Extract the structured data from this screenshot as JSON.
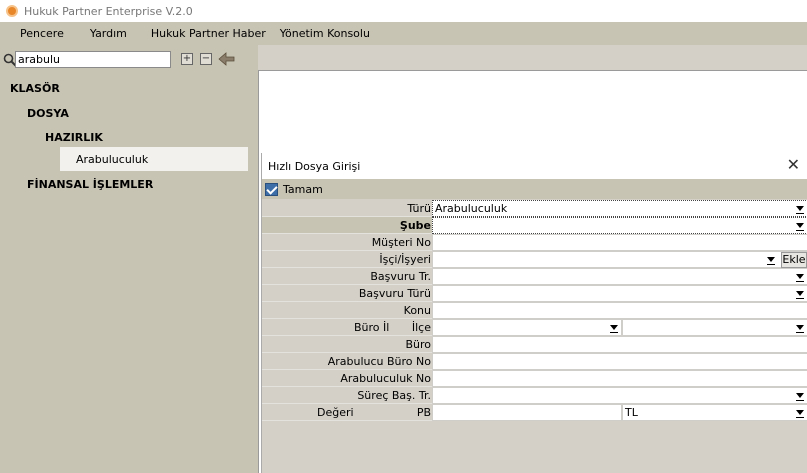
{
  "window": {
    "title": "Hukuk Partner Enterprise V.2.0"
  },
  "menu": [
    "Pencere",
    "Yardım",
    "Hukuk Partner Haber",
    "Yönetim Konsolu"
  ],
  "search": {
    "value": "arabulu",
    "expand_label": "+",
    "collapse_label": "−"
  },
  "tree": {
    "klasor": "KLASÖR",
    "dosya": "DOSYA",
    "hazirlik": "HAZIRLIK",
    "arabuluculuk": "Arabuluculuk",
    "finansal": "FİNANSAL İŞLEMLER"
  },
  "dialog": {
    "title": "Hızlı Dosya Girişi",
    "close_glyph": "✕",
    "tamam": "Tamam",
    "fields": {
      "turu": {
        "label": "Türü",
        "value": "Arabuluculuk"
      },
      "sube": {
        "label": "Şube",
        "value": ""
      },
      "musteri_no": {
        "label": "Müşteri No",
        "value": ""
      },
      "isci_isveren": {
        "label": "İşçi/İşyeri",
        "value": "",
        "button": "Ekle"
      },
      "basvuru_tr": {
        "label": "Başvuru Tr.",
        "value": ""
      },
      "basvuru_turu": {
        "label": "Başvuru Türü",
        "value": ""
      },
      "konu": {
        "label": "Konu",
        "value": ""
      },
      "buro_il": {
        "label": "Büro İl",
        "value": ""
      },
      "ilce": {
        "label": "İlçe",
        "value": ""
      },
      "buro": {
        "label": "Büro",
        "value": ""
      },
      "arabulucu_buro_no": {
        "label": "Arabulucu Büro No",
        "value": ""
      },
      "arabuluculuk_no": {
        "label": "Arabuluculuk No",
        "value": ""
      },
      "surec_bas_tr": {
        "label": "Süreç Baş. Tr.",
        "value": ""
      },
      "degeri": {
        "label": "Değeri",
        "value": ""
      },
      "pb": {
        "label": "PB",
        "value": "TL"
      }
    }
  }
}
